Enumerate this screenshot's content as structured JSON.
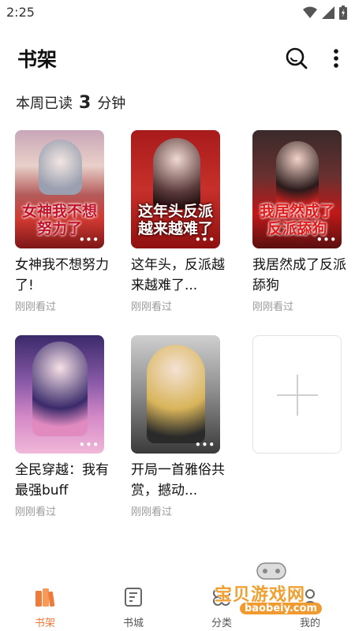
{
  "status_bar": {
    "time": "2:25"
  },
  "header": {
    "title": "书架"
  },
  "reading_stats": {
    "prefix": "本周已读",
    "minutes": "3",
    "unit": "分钟"
  },
  "books": [
    {
      "title": "女神我不想努力了!",
      "cover_text": "女神我不想 努力了",
      "status": "刚刚看过",
      "more": "•••"
    },
    {
      "title": "这年头，反派越来越难了...",
      "cover_text": "这年头反派 越来越难了",
      "status": "刚刚看过",
      "more": "•••"
    },
    {
      "title": "我居然成了反派舔狗",
      "cover_text": "我居然成了 反派舔狗",
      "status": "刚刚看过",
      "more": "•••"
    },
    {
      "title": "全民穿越：我有最强buff",
      "cover_text": "",
      "status": "刚刚看过",
      "more": "•••"
    },
    {
      "title": "开局一首雅俗共赏，撼动...",
      "cover_text": "",
      "status": "刚刚看过",
      "more": "•••"
    }
  ],
  "bottom_nav": [
    {
      "label": "书架",
      "icon": "bookshelf-icon",
      "active": true
    },
    {
      "label": "书城",
      "icon": "bookstore-icon",
      "active": false
    },
    {
      "label": "分类",
      "icon": "category-icon",
      "active": false
    },
    {
      "label": "我的",
      "icon": "profile-icon",
      "active": false
    }
  ],
  "watermark": {
    "text": "宝贝游戏网",
    "url": "baobeiy.com"
  },
  "colors": {
    "accent": "#f07a3a",
    "text": "#111111",
    "muted": "#9a9a9a"
  }
}
